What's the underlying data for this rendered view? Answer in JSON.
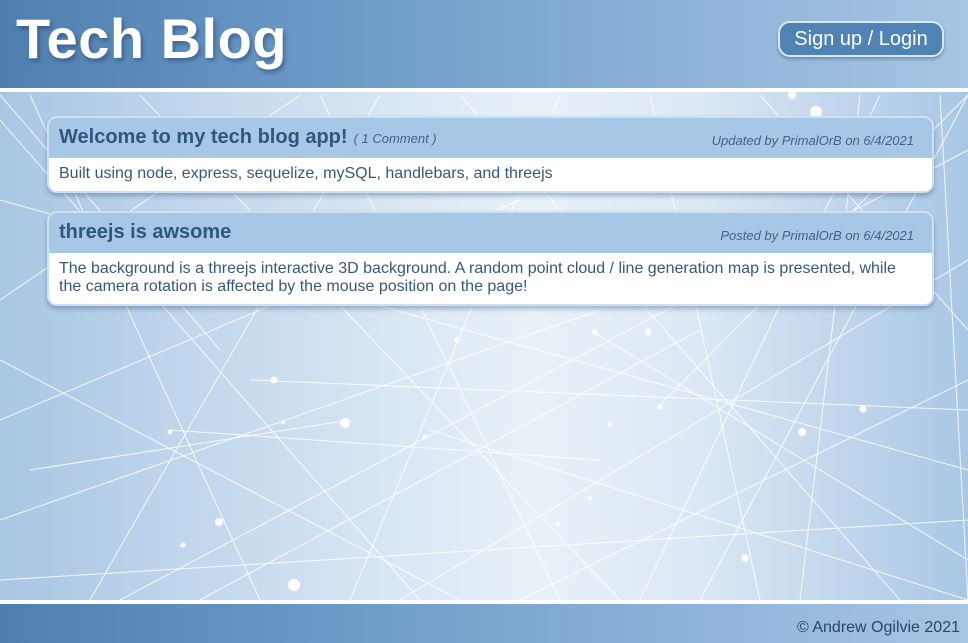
{
  "header": {
    "title": "Tech Blog",
    "auth_label": "Sign up / Login"
  },
  "posts": [
    {
      "title": "Welcome to my tech blog app!",
      "comments": "( 1 Comment )",
      "meta": "Updated by PrimalOrB on 6/4/2021",
      "body": "Built using node, express, sequelize, mySQL, handlebars, and threejs"
    },
    {
      "title": "threejs is awsome",
      "comments": "",
      "meta": "Posted by PrimalOrB on 6/4/2021",
      "body": "The background is a threejs interactive 3D background. A random point cloud / line generation map is presented, while the camera rotation is affected by the mouse position on the page!"
    }
  ],
  "footer": {
    "copyright": "© Andrew Ogilvie 2021"
  },
  "colors": {
    "header_blue": "#4f7fb0",
    "card_header": "#a7c7e6",
    "title_text": "#2f577e",
    "background_light": "#e9f1f8"
  }
}
